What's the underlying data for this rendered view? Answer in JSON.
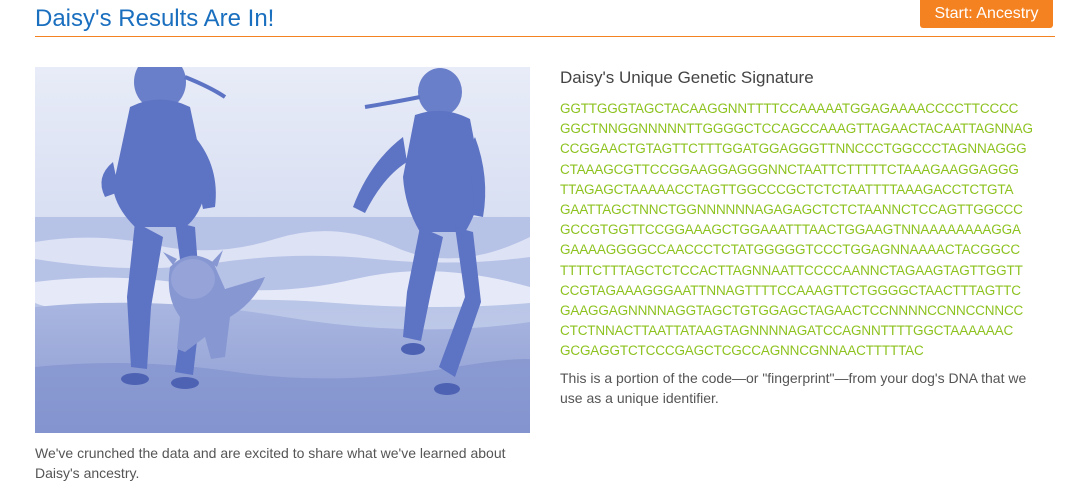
{
  "header": {
    "title": "Daisy's Results Are In!",
    "cta_label": "Start: Ancestry"
  },
  "photo": {
    "caption": "We've crunched the data and are excited to share what we've learned about Daisy's ancestry."
  },
  "signature": {
    "title": "Daisy's Unique Genetic Signature",
    "lines": [
      "GGTTGGGTAGCTACAAGGNNTTTTCCAAAAATGGAGAAAACCCCTTCCCC",
      "GGCTNNGGNNNNNTTGGGGCTCCAGCCAAAGTTAGAACTACAATTAGNNAG",
      "CCGGAACTGTAGTTCTTTGGATGGAGGGTTNNCCCTGGCCCTAGNNAGGG",
      "CTAAAGCGTTCCGGAAGGAGGGNNCTAATTCTTTTTCTAAAGAAGGAGGG",
      "TTAGAGCTAAAAACCTAGTTGGCCCGCTCTCTAATTTTAAAGACCTCTGTA",
      "GAATTAGCTNNCTGGNNNNNNAGAGAGCTCTCTAANNCTCCAGTTGGCCC",
      "GCCGTGGTTCCGGAAAGCTGGAAATTTAACTGGAAGTNNAAAAAAAAGGA",
      "GAAAAGGGGCCAACCCTCTATGGGGGTCCCTGGAGNNAAAACTACGGCC",
      "TTTTCTTTAGCTCTCCACTTAGNNAATTCCCCAANNCTAGAAGTAGTTGGTT",
      "CCGTAGAAAGGGAATTNNAGTTTTCCAAAGTTCTGGGGCTAACTTTAGTTC",
      "GAAGGAGNNNNAGGTAGCTGTGGAGCTAGAACTCCNNNNCCNNCCNNCC",
      "CTCTNNACTTAATTATAAGTAGNNNNAGATCCAGNNTTTTGGCTAAAAAAC",
      "GCGAGGTCTCCCGAGCTCGCCAGNNCGNNAACTTTTTAC"
    ],
    "note": "This is a portion of the code—or \"fingerprint\"—from your dog's DNA that we use as a unique identifier."
  },
  "colors": {
    "title_blue": "#1a6fbf",
    "accent_orange": "#f58220",
    "dna_green": "#8dc21f",
    "photo_tint": "#6f86cc"
  }
}
